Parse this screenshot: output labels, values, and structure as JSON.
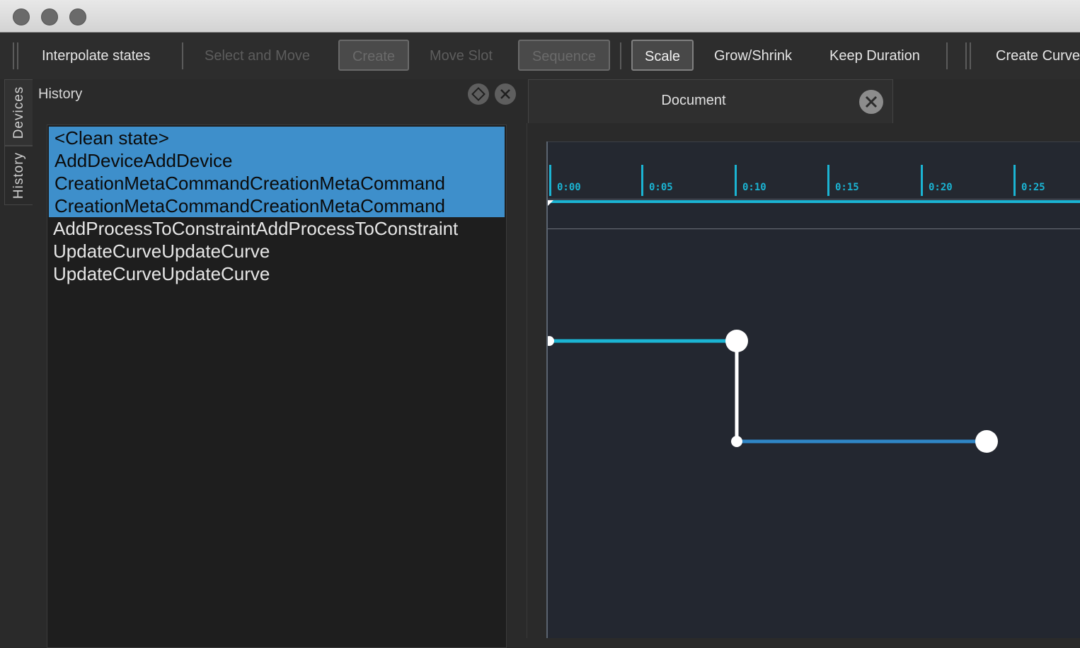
{
  "window": {
    "title": ""
  },
  "toolbar": {
    "interpolate": "Interpolate states",
    "select_move": "Select and Move",
    "create": "Create",
    "move_slot": "Move Slot",
    "sequence": "Sequence",
    "scale": "Scale",
    "grow_shrink": "Grow/Shrink",
    "keep_duration": "Keep Duration",
    "create_curve": "Create Curve"
  },
  "side_tabs": {
    "devices": "Devices",
    "history": "History"
  },
  "history_panel": {
    "title": "History",
    "items": [
      {
        "label": "<Clean state>",
        "selected": true
      },
      {
        "label": "AddDeviceAddDevice",
        "selected": true
      },
      {
        "label": "CreationMetaCommandCreationMetaCommand",
        "selected": true
      },
      {
        "label": "CreationMetaCommandCreationMetaCommand",
        "selected": true
      },
      {
        "label": "AddProcessToConstraintAddProcessToConstraint",
        "selected": false
      },
      {
        "label": "UpdateCurveUpdateCurve",
        "selected": false
      },
      {
        "label": "UpdateCurveUpdateCurve",
        "selected": false
      }
    ]
  },
  "document": {
    "tab_label": "Document",
    "ruler_ticks": [
      "0:00",
      "0:05",
      "0:10",
      "0:15",
      "0:20",
      "0:25"
    ]
  },
  "colors": {
    "accent_cyan": "#1bb4d3",
    "selection_blue": "#3e8fcb",
    "curve_blue": "#2f86c6"
  }
}
